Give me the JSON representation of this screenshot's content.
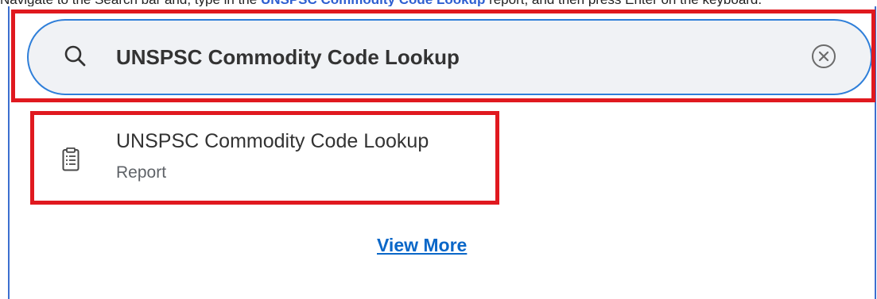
{
  "instruction": {
    "prefix": "Navigate to the Search bar and, type in the ",
    "highlight": "UNSPSC Commodity Code Lookup",
    "suffix": " report, and then press Enter on the keyboard."
  },
  "search": {
    "value": "UNSPSC Commodity Code Lookup",
    "search_icon": "search-icon",
    "clear_icon": "close-circle-icon"
  },
  "results": [
    {
      "icon": "report-clipboard-icon",
      "title": "UNSPSC Commodity Code Lookup",
      "subtitle": "Report"
    }
  ],
  "view_more_label": "View More",
  "colors": {
    "highlight_border": "#e0191f",
    "focus_border": "#2f7fd9",
    "popup_border": "#3d6fcf",
    "link": "#0a67c8",
    "search_bg": "#f0f2f5"
  }
}
